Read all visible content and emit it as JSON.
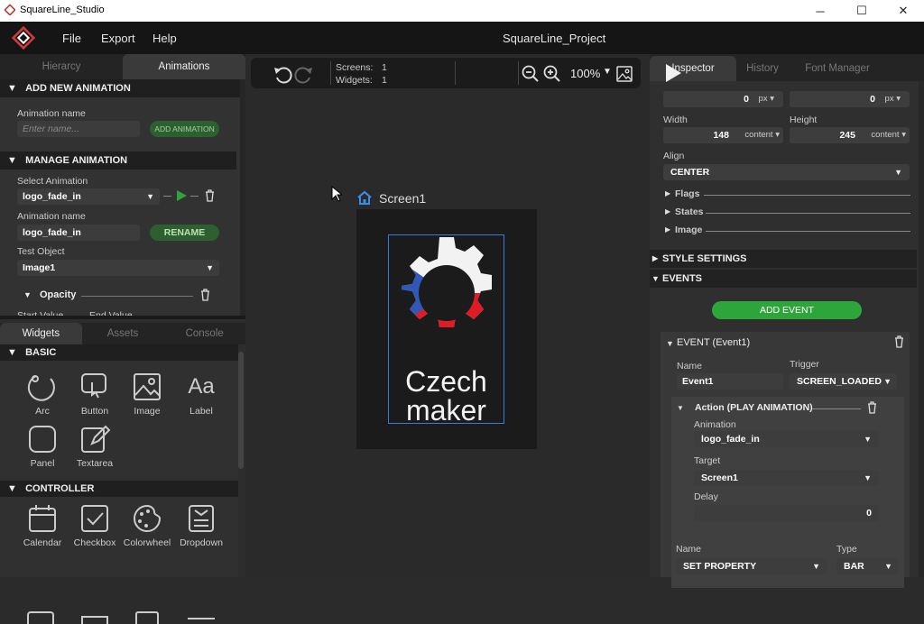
{
  "app": {
    "title": "SquareLine_Studio",
    "project": "SquareLine_Project"
  },
  "window_controls": {
    "minimize": "─",
    "maximize": "☐",
    "close": "✕"
  },
  "menu": {
    "file": "File",
    "export": "Export",
    "help": "Help"
  },
  "left_tabs_top": {
    "hierarcy": "Hierarcy",
    "animations": "Animations"
  },
  "add_animation": {
    "header": "ADD NEW ANIMATION",
    "name_label": "Animation name",
    "name_placeholder": "Enter name...",
    "button": "ADD ANIMATION"
  },
  "manage_animation": {
    "header": "MANAGE ANIMATION",
    "select_label": "Select Animation",
    "select_value": "logo_fade_in",
    "name_label": "Animation name",
    "name_value": "logo_fade_in",
    "rename": "RENAME",
    "test_object_label": "Test Object",
    "test_object_value": "Image1",
    "opacity": "Opacity",
    "start_value": "Start Value",
    "end_value": "End Value"
  },
  "left_tabs_bottom": {
    "widgets": "Widgets",
    "assets": "Assets",
    "console": "Console"
  },
  "basic": {
    "header": "BASIC",
    "items": [
      {
        "label": "Arc",
        "icon": "arc-icon"
      },
      {
        "label": "Button",
        "icon": "button-icon"
      },
      {
        "label": "Image",
        "icon": "image-icon"
      },
      {
        "label": "Label",
        "icon": "label-icon",
        "glyph": "Aa"
      },
      {
        "label": "Panel",
        "icon": "panel-icon"
      },
      {
        "label": "Textarea",
        "icon": "textarea-icon"
      }
    ]
  },
  "controller": {
    "header": "CONTROLLER",
    "items": [
      {
        "label": "Calendar",
        "icon": "calendar-icon"
      },
      {
        "label": "Checkbox",
        "icon": "checkbox-icon"
      },
      {
        "label": "Colorwheel",
        "icon": "colorwheel-icon"
      },
      {
        "label": "Dropdown",
        "icon": "dropdown-icon"
      }
    ]
  },
  "toolbar": {
    "screens_label": "Screens:",
    "screens_value": "1",
    "widgets_label": "Widgets:",
    "widgets_value": "1",
    "zoom": "100%"
  },
  "canvas": {
    "screen_name": "Screen1",
    "logo_line1": "Czech",
    "logo_line2": "maker"
  },
  "right_tabs": {
    "inspector": "Inspector",
    "history": "History",
    "font_manager": "Font Manager"
  },
  "inspector": {
    "x_value": "0",
    "y_value": "0",
    "unit_px": "px",
    "width_label": "Width",
    "width_value": "148",
    "width_unit": "content",
    "height_label": "Height",
    "height_value": "245",
    "height_unit": "content",
    "align_label": "Align",
    "align_value": "CENTER",
    "flags": "Flags",
    "states": "States",
    "image": "Image",
    "style_settings": "STYLE SETTINGS",
    "events": "EVENTS",
    "add_event": "ADD EVENT",
    "event_title": "EVENT (Event1)",
    "event_name_label": "Name",
    "event_name_value": "Event1",
    "trigger_label": "Trigger",
    "trigger_value": "SCREEN_LOADED",
    "action_title": "Action (PLAY ANIMATION)",
    "animation_label": "Animation",
    "animation_value": "logo_fade_in",
    "target_label": "Target",
    "target_value": "Screen1",
    "delay_label": "Delay",
    "delay_value": "0",
    "name2_label": "Name",
    "name2_value": "SET PROPERTY",
    "type_label": "Type",
    "type_value": "BAR"
  },
  "colors": {
    "accent_green": "#2ea53a",
    "selection_blue": "#3a7bd5",
    "logo_red": "#e01b24",
    "logo_blue": "#2f58b8"
  }
}
